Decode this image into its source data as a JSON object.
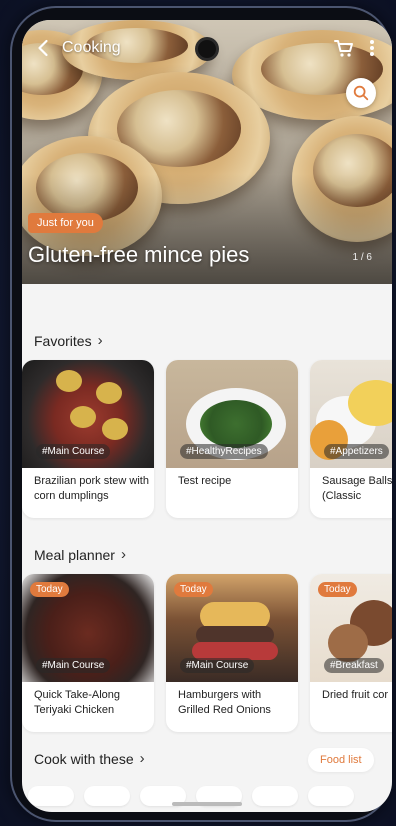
{
  "header": {
    "title": "Cooking"
  },
  "hero": {
    "badge": "Just for you",
    "title": "Gluten-free mince pies",
    "pager": "1 / 6"
  },
  "sections": {
    "favorites": {
      "title": "Favorites",
      "cards": [
        {
          "tag": "#Main Course",
          "title": "Brazilian pork stew with corn dumplings"
        },
        {
          "tag": "#HealthyRecipes",
          "title": "Test recipe"
        },
        {
          "tag": "#Appetizers",
          "title": "Sausage Balls Recipe (Classic"
        }
      ]
    },
    "meal_planner": {
      "title": "Meal planner",
      "cards": [
        {
          "badge": "Today",
          "tag": "#Main Course",
          "title": "Quick Take-Along Teriyaki Chicken"
        },
        {
          "badge": "Today",
          "tag": "#Main Course",
          "title": "Hamburgers with Grilled Red Onions"
        },
        {
          "badge": "Today",
          "tag": "#Breakfast",
          "title": "Dried fruit cor"
        }
      ]
    },
    "cook_with_these": {
      "title": "Cook with these",
      "food_list_label": "Food list"
    }
  },
  "colors": {
    "accent": "#e07a3d",
    "background": "#f4f4f4"
  },
  "icons": [
    "back-icon",
    "cart-icon",
    "more-icon",
    "search-icon",
    "chevron-right-icon"
  ]
}
